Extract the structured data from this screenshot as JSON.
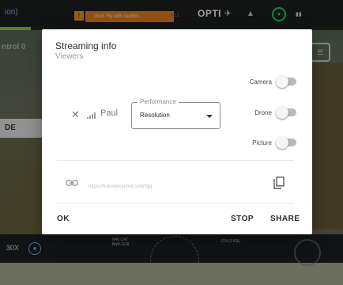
{
  "app": {
    "mode_label": "ion)",
    "warning_badge": "!",
    "warning_text": "dwd: Fly with caution",
    "red_value": "A11",
    "brand": "OPTI",
    "gps_icon": "gps-icon",
    "left_text": "ntrol",
    "left_value": "0",
    "left_button": "DE",
    "bottom_left": "30X",
    "bottom_mid_line1": "N46 C47",
    "bottom_mid_line2": "Ba% G18",
    "bottom_right": "D74.2 KSL",
    "colors": {
      "warning": "#e8841e",
      "accent": "#21d36c",
      "progress": "#8fd23a",
      "mode_label": "#7fb6e6"
    }
  },
  "dialog": {
    "title": "Streaming info",
    "subtitle": "Viewers",
    "viewer": {
      "name": "Paul",
      "remove_icon": "close-icon",
      "signal_icon": "signal-icon"
    },
    "performance": {
      "label": "Performance",
      "value": "Resolution"
    },
    "toggles": [
      {
        "label": "Camera",
        "on": false
      },
      {
        "label": "Drone",
        "on": false
      },
      {
        "label": "Picture",
        "on": false
      }
    ],
    "link": {
      "icon": "link-icon",
      "url": "https://ft.dronecontrol.co/w3gq",
      "copy_icon": "copy-icon"
    },
    "buttons": {
      "ok": "OK",
      "stop": "STOP",
      "share": "SHARE"
    }
  }
}
